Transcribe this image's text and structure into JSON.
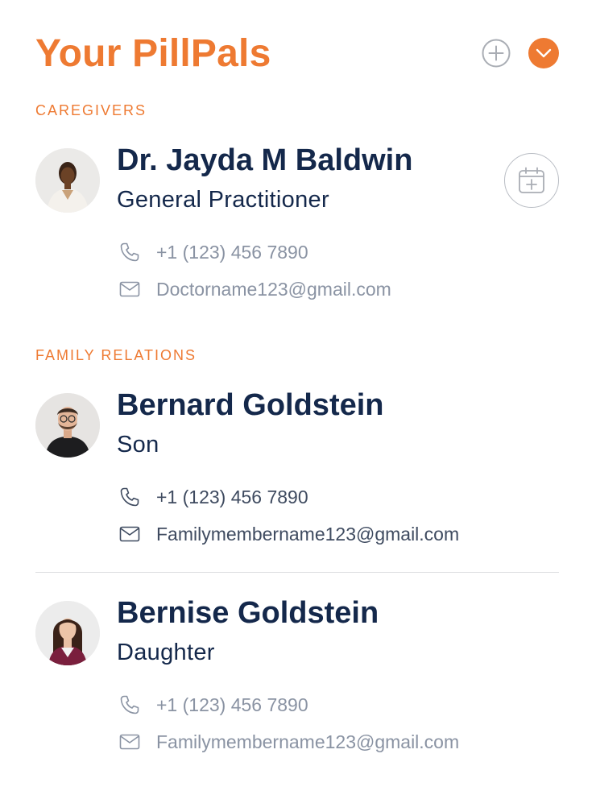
{
  "header": {
    "title": "Your PillPals",
    "accent_color": "#ee7a32"
  },
  "sections": {
    "caregivers_label": "CAREGIVERS",
    "family_label": "FAMILY RELATIONS"
  },
  "caregivers": [
    {
      "name": "Dr. Jayda M Baldwin",
      "role": "General Practitioner",
      "phone": "+1 (123) 456 7890",
      "email": "Doctorname123@gmail.com"
    }
  ],
  "family": [
    {
      "name": "Bernard Goldstein",
      "role": "Son",
      "phone": "+1 (123) 456 7890",
      "email": "Familymembername123@gmail.com"
    },
    {
      "name": "Bernise Goldstein",
      "role": "Daughter",
      "phone": "+1 (123) 456 7890",
      "email": "Familymembername123@gmail.com"
    }
  ],
  "icons": {
    "add": "plus-circle-icon",
    "collapse": "chevron-down-icon",
    "calendar": "calendar-add-icon",
    "phone": "phone-icon",
    "email": "mail-icon"
  }
}
